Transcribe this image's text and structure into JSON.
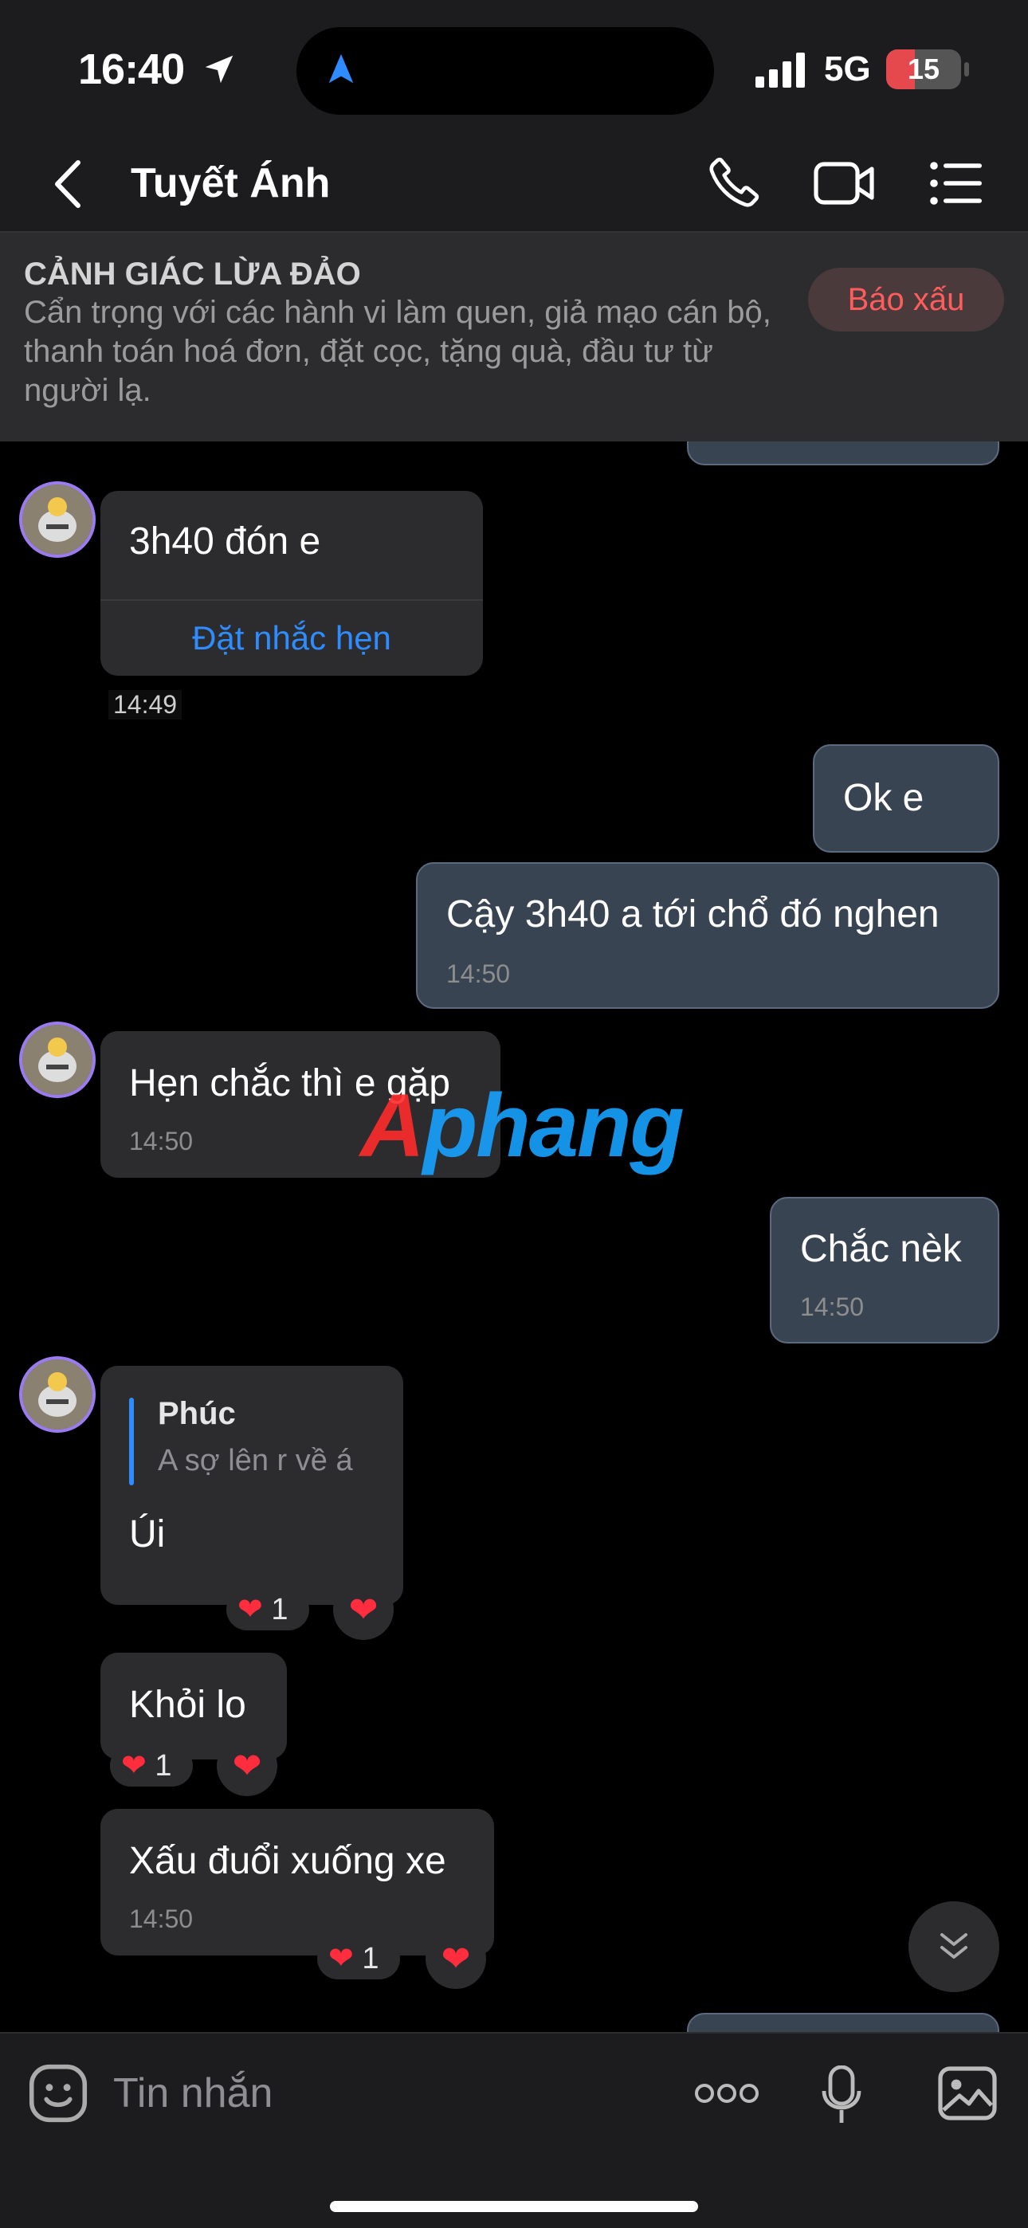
{
  "status_bar": {
    "time": "16:40",
    "network": "5G",
    "battery": "15"
  },
  "header": {
    "contact_name": "Tuyết Ánh"
  },
  "warning": {
    "title": "CẢNH GIÁC LỪA ĐẢO",
    "text": "Cẩn trọng với các hành vi làm quen, giả mạo cán bộ, thanh toán hoá đơn, đặt cọc, tặng quà, đầu tư từ người lạ.",
    "report_label": "Báo xấu"
  },
  "messages": {
    "m1": {
      "text": "3h40 đón e",
      "action": "Đặt nhắc hẹn",
      "time": "14:49"
    },
    "m2": {
      "text": "Ok e"
    },
    "m3": {
      "text": "Cậy 3h40 a tới chổ đó nghen",
      "time": "14:50"
    },
    "m4": {
      "text": "Hẹn chắc thì e gặp",
      "time": "14:50"
    },
    "m5": {
      "text": "Chắc nèk",
      "time": "14:50"
    },
    "m6": {
      "quote_author": "Phúc",
      "quote_text": "A sợ lên r về á",
      "text": "Úi",
      "reaction_count": "1"
    },
    "m7": {
      "text": "Khỏi lo",
      "reaction_count": "1"
    },
    "m8": {
      "text": "Xấu đuổi xuống xe",
      "time": "14:50",
      "reaction_count": "1"
    }
  },
  "watermark": {
    "part1": "A",
    "part2": "phang"
  },
  "composer": {
    "placeholder": "Tin nhắn"
  },
  "colors": {
    "accent": "#2f8cff",
    "heart": "#ff2d3e",
    "outgoing_bubble": "#394452",
    "incoming_bubble": "#2c2c2e"
  }
}
